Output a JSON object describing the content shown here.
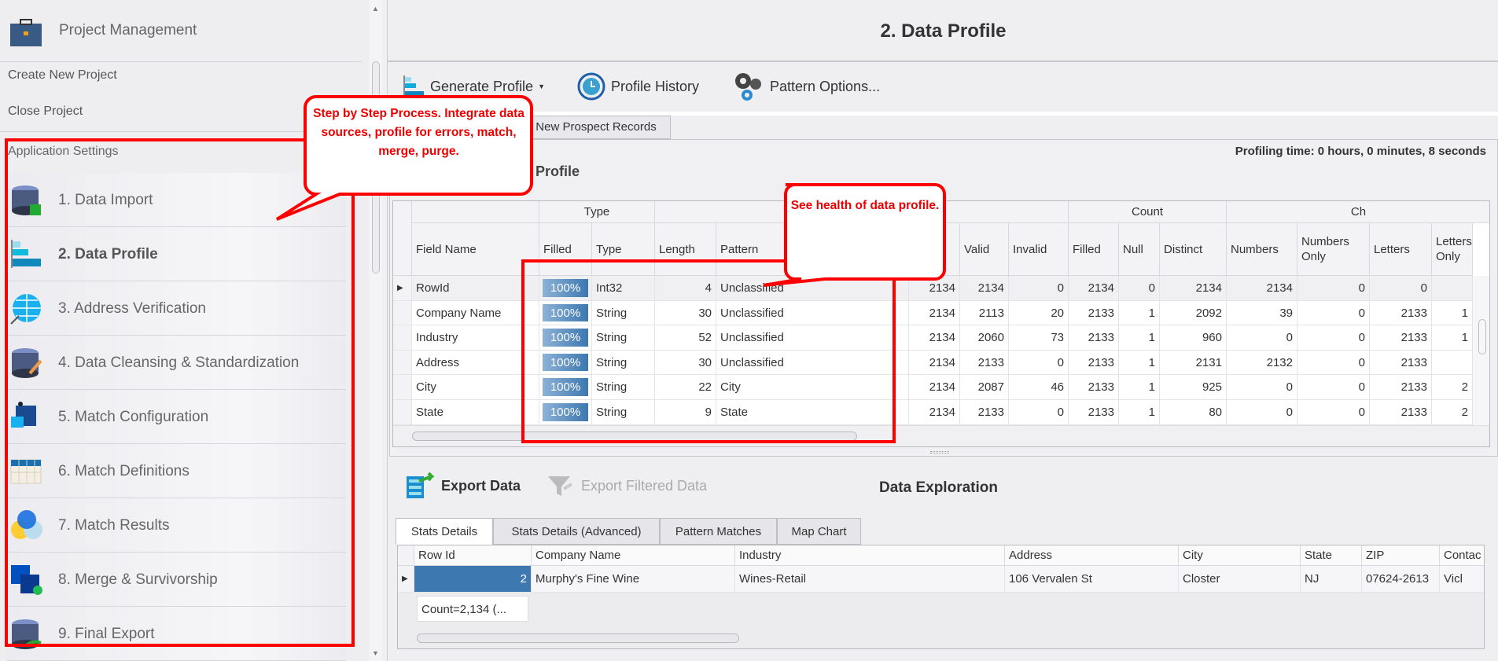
{
  "sidebar": {
    "header": {
      "label": "Project Management",
      "icon": "briefcase-icon"
    },
    "links": [
      "Create New Project",
      "Close Project"
    ],
    "section": "Application Settings",
    "items": [
      {
        "label": "1. Data Import",
        "icon": "database-import-icon"
      },
      {
        "label": "2. Data Profile",
        "icon": "bar-chart-icon",
        "active": true
      },
      {
        "label": "3. Address Verification",
        "icon": "globe-search-icon"
      },
      {
        "label": "4. Data Cleansing & Standardization",
        "icon": "database-broom-icon"
      },
      {
        "label": "5. Match Configuration",
        "icon": "puzzle-icon"
      },
      {
        "label": "6. Match Definitions",
        "icon": "table-grid-icon"
      },
      {
        "label": "7. Match Results",
        "icon": "venn-circles-icon"
      },
      {
        "label": "8. Merge & Survivorship",
        "icon": "merge-squares-icon"
      },
      {
        "label": "9. Final Export",
        "icon": "database-export-icon"
      }
    ]
  },
  "main": {
    "title": "2. Data Profile",
    "toolbar": {
      "generate": "Generate Profile",
      "history": "Profile History",
      "pattern": "Pattern Options..."
    },
    "source_tab": "New Prospect Records",
    "profiling_time": "Profiling time: 0 hours, 0 minutes, 8 seconds",
    "section_label": "Profile",
    "profile_grid": {
      "bands": [
        "",
        "Type",
        "",
        "Count",
        "Ch"
      ],
      "columns": [
        "Field Name",
        "Filled",
        "Type",
        "Length",
        "Pattern",
        "",
        "Valid",
        "Invalid",
        "Filled",
        "Null",
        "Distinct",
        "Numbers",
        "Numbers Only",
        "Letters",
        "Letters Only"
      ],
      "rows": [
        [
          "RowId",
          "100%",
          "Int32",
          "4",
          "Unclassified",
          "2134",
          "2134",
          "0",
          "2134",
          "0",
          "2134",
          "2134",
          "0",
          "0",
          ""
        ],
        [
          "Company Name",
          "100%",
          "String",
          "30",
          "Unclassified",
          "2134",
          "2113",
          "20",
          "2133",
          "1",
          "2092",
          "39",
          "0",
          "2133",
          "1"
        ],
        [
          "Industry",
          "100%",
          "String",
          "52",
          "Unclassified",
          "2134",
          "2060",
          "73",
          "2133",
          "1",
          "960",
          "0",
          "0",
          "2133",
          "1"
        ],
        [
          "Address",
          "100%",
          "String",
          "30",
          "Unclassified",
          "2134",
          "2133",
          "0",
          "2133",
          "1",
          "2131",
          "2132",
          "0",
          "2133",
          ""
        ],
        [
          "City",
          "100%",
          "String",
          "22",
          "City",
          "2134",
          "2087",
          "46",
          "2133",
          "1",
          "925",
          "0",
          "0",
          "2133",
          "2"
        ],
        [
          "State",
          "100%",
          "String",
          "9",
          "State",
          "2134",
          "2133",
          "0",
          "2133",
          "1",
          "80",
          "0",
          "0",
          "2133",
          "2"
        ]
      ],
      "filled_fraction": [
        1,
        1,
        1,
        1,
        1,
        1
      ]
    },
    "export": {
      "export_data": "Export Data",
      "export_filtered": "Export Filtered Data",
      "title": "Data Exploration"
    },
    "tabs": [
      "Stats Details",
      "Stats Details (Advanced)",
      "Pattern Matches",
      "Map Chart"
    ],
    "stats_grid": {
      "columns": [
        "Row Id",
        "Company Name",
        "Industry",
        "Address",
        "City",
        "State",
        "ZIP",
        "Contac"
      ],
      "rows": [
        [
          "2",
          "Murphy's Fine Wine",
          "Wines-Retail",
          "106 Vervalen St",
          "Closter",
          "NJ",
          "07624-2613",
          "Vicl"
        ]
      ],
      "summary": "Count=2,134 (..."
    }
  },
  "callouts": {
    "steps": "Step by Step Process. Integrate data sources, profile for errors, match, merge, purge.",
    "health": "See health of data profile."
  },
  "colors": {
    "accent": "#3d78b0",
    "annotation": "#ff0000"
  }
}
